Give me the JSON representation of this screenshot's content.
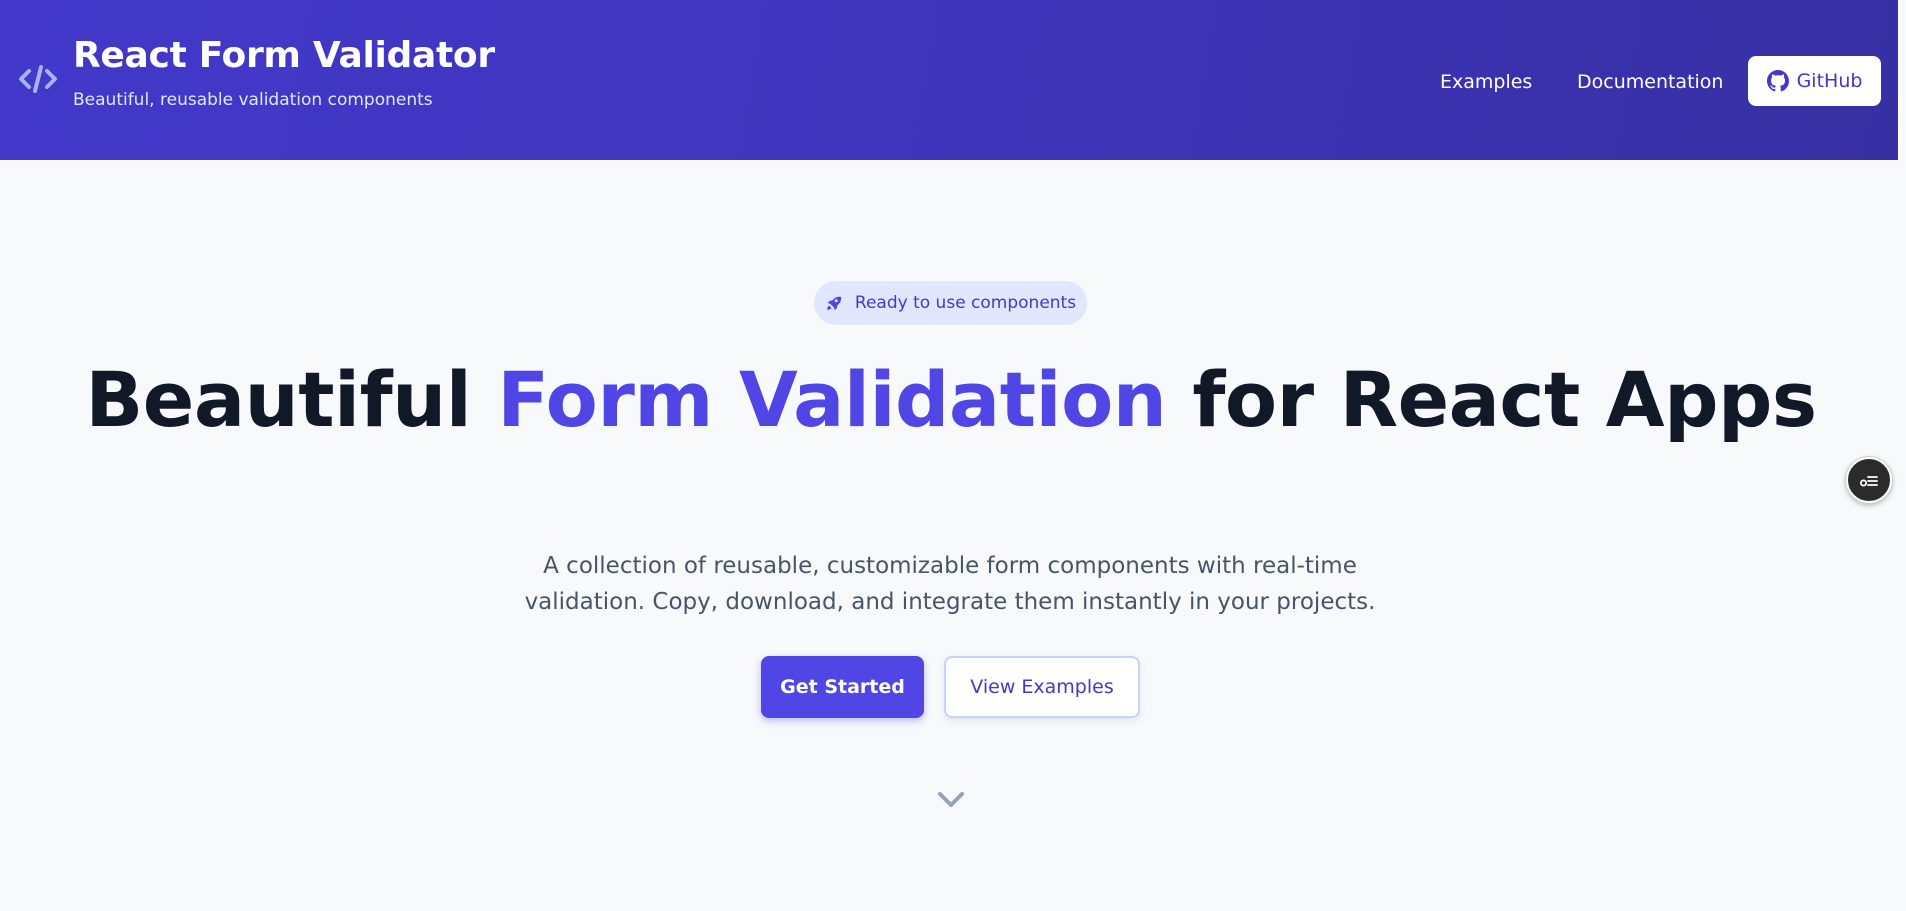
{
  "header": {
    "title": "React Form Validator",
    "subtitle": "Beautiful, reusable validation components",
    "logo_icon": "code-icon",
    "nav": {
      "examples": "Examples",
      "documentation": "Documentation",
      "github": "GitHub"
    }
  },
  "hero": {
    "badge": "Ready to use components",
    "badge_icon": "rocket-icon",
    "title_part1": "Beautiful ",
    "title_accent": "Form Validation",
    "title_part2": " for React Apps",
    "description": "A collection of reusable, customizable form components with real-time validation. Copy, download, and integrate them instantly in your projects.",
    "primary_button": "Get Started",
    "secondary_button": "View Examples",
    "scroll_icon": "chevron-down-icon"
  },
  "floating": {
    "icon": "list-settings-icon"
  },
  "colors": {
    "header_bg": "#4338ca",
    "accent": "#4f46e5",
    "title_text": "#111827",
    "body_text": "#475569",
    "page_bg": "#f8f9fb"
  }
}
